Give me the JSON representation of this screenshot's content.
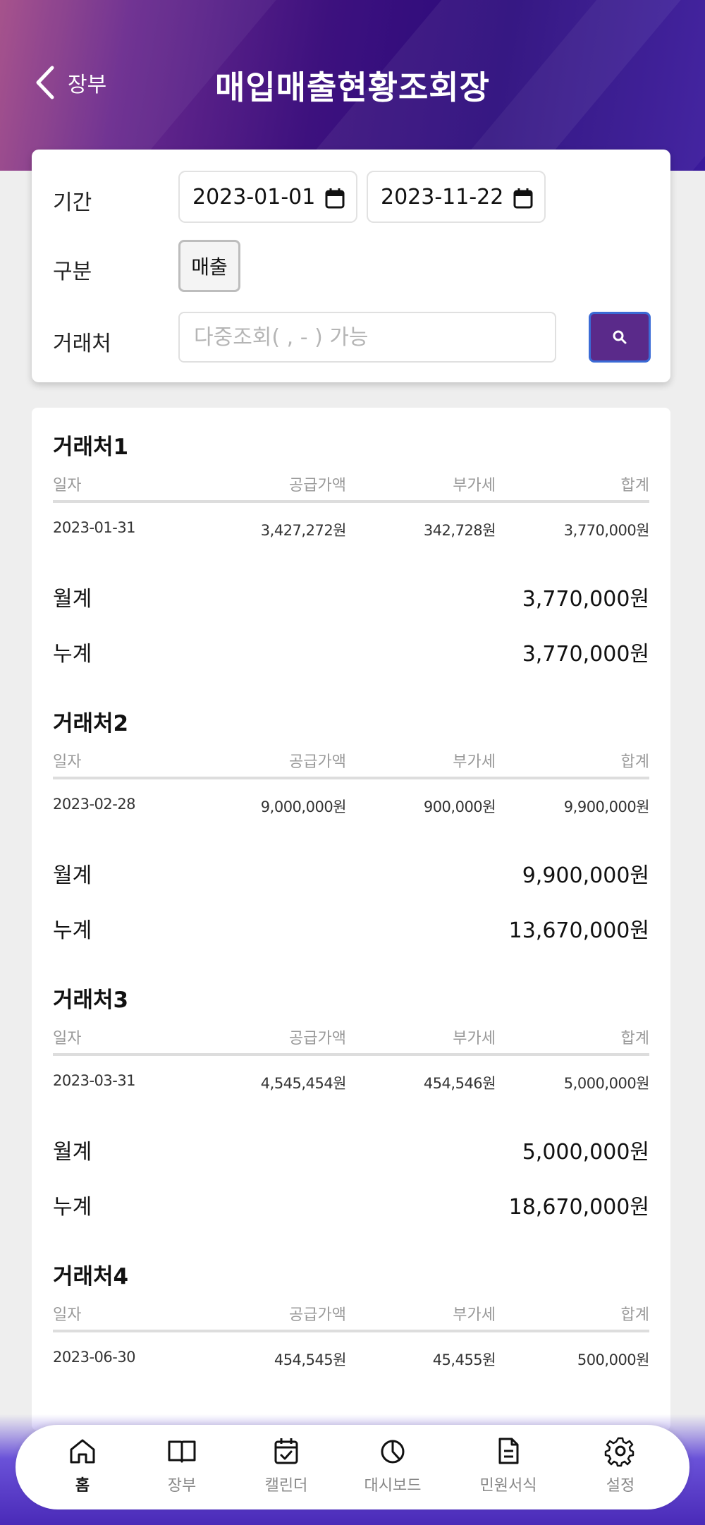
{
  "header": {
    "back_label": "장부",
    "title": "매입매출현황조회장"
  },
  "filter": {
    "period_label": "기간",
    "start_date": "2023-01-01",
    "end_date": "2023-11-22",
    "category_label": "구분",
    "category_value": "매출",
    "vendor_label": "거래처",
    "vendor_placeholder": "다중조회( , - ) 가능"
  },
  "columns": [
    "일자",
    "공급가액",
    "부가세",
    "합계"
  ],
  "vendors": [
    {
      "name": "거래처1",
      "row": {
        "date": "2023-01-31",
        "supply": "3,427,272원",
        "vat": "342,728원",
        "total": "3,770,000원"
      },
      "monthly_label": "월계",
      "monthly": "3,770,000원",
      "cumulative_label": "누계",
      "cumulative": "3,770,000원"
    },
    {
      "name": "거래처2",
      "row": {
        "date": "2023-02-28",
        "supply": "9,000,000원",
        "vat": "900,000원",
        "total": "9,900,000원"
      },
      "monthly_label": "월계",
      "monthly": "9,900,000원",
      "cumulative_label": "누계",
      "cumulative": "13,670,000원"
    },
    {
      "name": "거래처3",
      "row": {
        "date": "2023-03-31",
        "supply": "4,545,454원",
        "vat": "454,546원",
        "total": "5,000,000원"
      },
      "monthly_label": "월계",
      "monthly": "5,000,000원",
      "cumulative_label": "누계",
      "cumulative": "18,670,000원"
    },
    {
      "name": "거래처4",
      "row": {
        "date": "2023-06-30",
        "supply": "454,545원",
        "vat": "45,455원",
        "total": "500,000원"
      }
    }
  ],
  "tabs": [
    {
      "label": "홈",
      "icon": "home-icon"
    },
    {
      "label": "장부",
      "icon": "book-icon"
    },
    {
      "label": "캘린더",
      "icon": "calendar-icon"
    },
    {
      "label": "대시보드",
      "icon": "chart-pie-icon"
    },
    {
      "label": "민원서식",
      "icon": "document-icon"
    },
    {
      "label": "설정",
      "icon": "gear-icon"
    }
  ]
}
